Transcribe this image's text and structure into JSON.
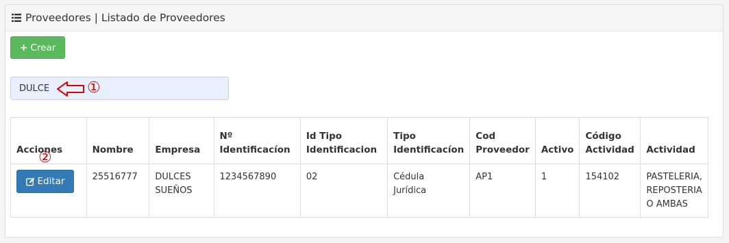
{
  "panel": {
    "title": "Proveedores | Listado de Proveedores"
  },
  "toolbar": {
    "create_label": "Crear"
  },
  "search": {
    "value": "DULCE"
  },
  "annotations": {
    "step1": "①",
    "step2": "②"
  },
  "table": {
    "headers": {
      "acciones": "Acciones",
      "nombre": "Nombre",
      "empresa": "Empresa",
      "identificacion_1": "Nº",
      "identificacion_2": "Identificacíon",
      "id_tipo_1": "Id Tipo",
      "id_tipo_2": "Identificacion",
      "tipo_1": "Tipo",
      "tipo_2": "Identificacíon",
      "cod_1": "Cod",
      "cod_2": "Proveedor",
      "activo": "Activo",
      "codigo_act_1": "Código",
      "codigo_act_2": "Actividad",
      "actividad": "Actividad"
    },
    "rows": [
      {
        "edit_label": "Editar",
        "nombre": "25516777",
        "empresa_1": "DULCES",
        "empresa_2": "SUEÑOS",
        "identificacion": "1234567890",
        "id_tipo": "02",
        "tipo_1": "Cédula",
        "tipo_2": "Jurídica",
        "cod_proveedor": "AP1",
        "activo": "1",
        "codigo_actividad": "154102",
        "actividad_1": "PASTELERIA,",
        "actividad_2": "REPOSTERIA",
        "actividad_3": "O AMBAS"
      }
    ]
  }
}
